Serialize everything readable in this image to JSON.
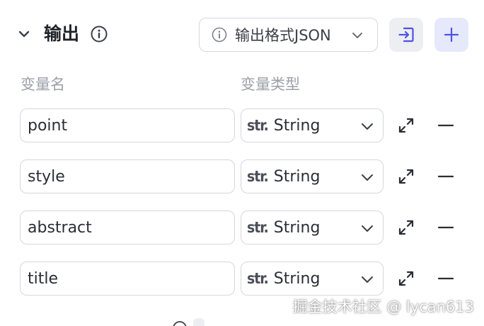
{
  "header": {
    "title": "输出",
    "output_format_label": "输出格式JSON"
  },
  "columns": {
    "name": "变量名",
    "type": "变量类型"
  },
  "variables": [
    {
      "name": "point",
      "type_prefix": "str.",
      "type": "String"
    },
    {
      "name": "style",
      "type_prefix": "str.",
      "type": "String"
    },
    {
      "name": "abstract",
      "type_prefix": "str.",
      "type": "String"
    },
    {
      "name": "title",
      "type_prefix": "str.",
      "type": "String"
    }
  ],
  "watermark": "掘金技术社区 @ lycan613",
  "colors": {
    "accent": "#4d53e8",
    "border": "#d5d7dc",
    "muted_text": "#9ba0a8",
    "add_button_bg": "#e6e8fb"
  }
}
